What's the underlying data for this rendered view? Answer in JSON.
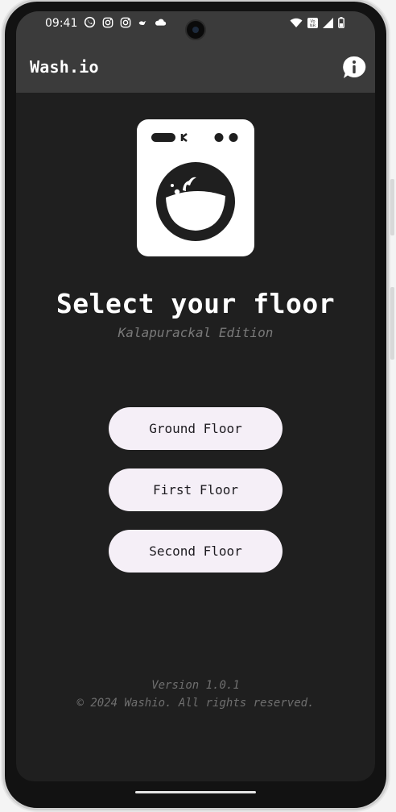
{
  "status_bar": {
    "time": "09:41",
    "left_icons": [
      "whatsapp-icon",
      "instagram-icon",
      "instagram-icon",
      "bird-icon",
      "cloud-icon"
    ],
    "right_icons": [
      "wifi-icon",
      "volte-icon",
      "signal-icon",
      "battery-icon"
    ],
    "volte_text": "Vo\nNR"
  },
  "app_bar": {
    "title": "Wash.io",
    "info_icon": "info-icon"
  },
  "main": {
    "logo_icon": "washing-machine-icon",
    "heading": "Select your floor",
    "subheading": "Kalapurackal Edition",
    "floors": [
      {
        "label": "Ground Floor"
      },
      {
        "label": "First Floor"
      },
      {
        "label": "Second Floor"
      }
    ]
  },
  "footer": {
    "version": "Version 1.0.1",
    "copyright": "© 2024 Washio. All rights reserved."
  },
  "colors": {
    "background": "#1f1f1f",
    "app_bar": "#3b3b3b",
    "button_bg": "#f5eff7",
    "button_text": "#1d1b20",
    "muted_text": "#7a7a7a"
  }
}
